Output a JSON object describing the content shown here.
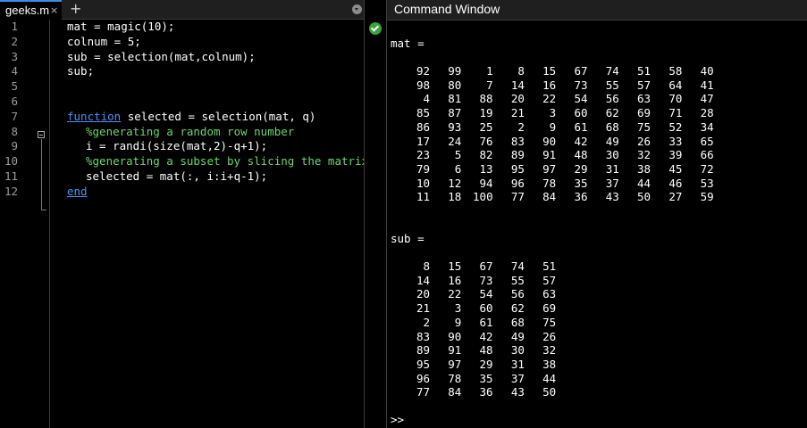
{
  "editor": {
    "tab_label": "geeks.m",
    "tab_close": "×",
    "tab_add": "+",
    "line_numbers": [
      "1",
      "2",
      "3",
      "4",
      "5",
      "6",
      "7",
      "8",
      "9",
      "10",
      "11",
      "12"
    ],
    "code": {
      "l1": "mat = magic(10);",
      "l2": "colnum = 5;",
      "l3": "sub = selection(mat,colnum);",
      "l4": "sub;",
      "l7_kw": "function",
      "l7_rest": " selected = selection(mat, q)",
      "l8": "%generating a random row number",
      "l9": "i = randi(size(mat,2)-q+1);",
      "l10": "%generating a subset by slicing the matrix",
      "l11": "selected = mat(:, i:i+q-1);",
      "l12": "end"
    },
    "colors": {
      "keyword": "#4f8ef5",
      "comment": "#6bd66b",
      "ok": "#3aa33a"
    }
  },
  "command_window": {
    "title": "Command Window",
    "mat_label": "mat =",
    "sub_label": "sub =",
    "prompt": ">>",
    "mat": [
      [
        92,
        99,
        1,
        8,
        15,
        67,
        74,
        51,
        58,
        40
      ],
      [
        98,
        80,
        7,
        14,
        16,
        73,
        55,
        57,
        64,
        41
      ],
      [
        4,
        81,
        88,
        20,
        22,
        54,
        56,
        63,
        70,
        47
      ],
      [
        85,
        87,
        19,
        21,
        3,
        60,
        62,
        69,
        71,
        28
      ],
      [
        86,
        93,
        25,
        2,
        9,
        61,
        68,
        75,
        52,
        34
      ],
      [
        17,
        24,
        76,
        83,
        90,
        42,
        49,
        26,
        33,
        65
      ],
      [
        23,
        5,
        82,
        89,
        91,
        48,
        30,
        32,
        39,
        66
      ],
      [
        79,
        6,
        13,
        95,
        97,
        29,
        31,
        38,
        45,
        72
      ],
      [
        10,
        12,
        94,
        96,
        78,
        35,
        37,
        44,
        46,
        53
      ],
      [
        11,
        18,
        100,
        77,
        84,
        36,
        43,
        50,
        27,
        59
      ]
    ],
    "sub": [
      [
        8,
        15,
        67,
        74,
        51
      ],
      [
        14,
        16,
        73,
        55,
        57
      ],
      [
        20,
        22,
        54,
        56,
        63
      ],
      [
        21,
        3,
        60,
        62,
        69
      ],
      [
        2,
        9,
        61,
        68,
        75
      ],
      [
        83,
        90,
        42,
        49,
        26
      ],
      [
        89,
        91,
        48,
        30,
        32
      ],
      [
        95,
        97,
        29,
        31,
        38
      ],
      [
        96,
        78,
        35,
        37,
        44
      ],
      [
        77,
        84,
        36,
        43,
        50
      ]
    ]
  }
}
